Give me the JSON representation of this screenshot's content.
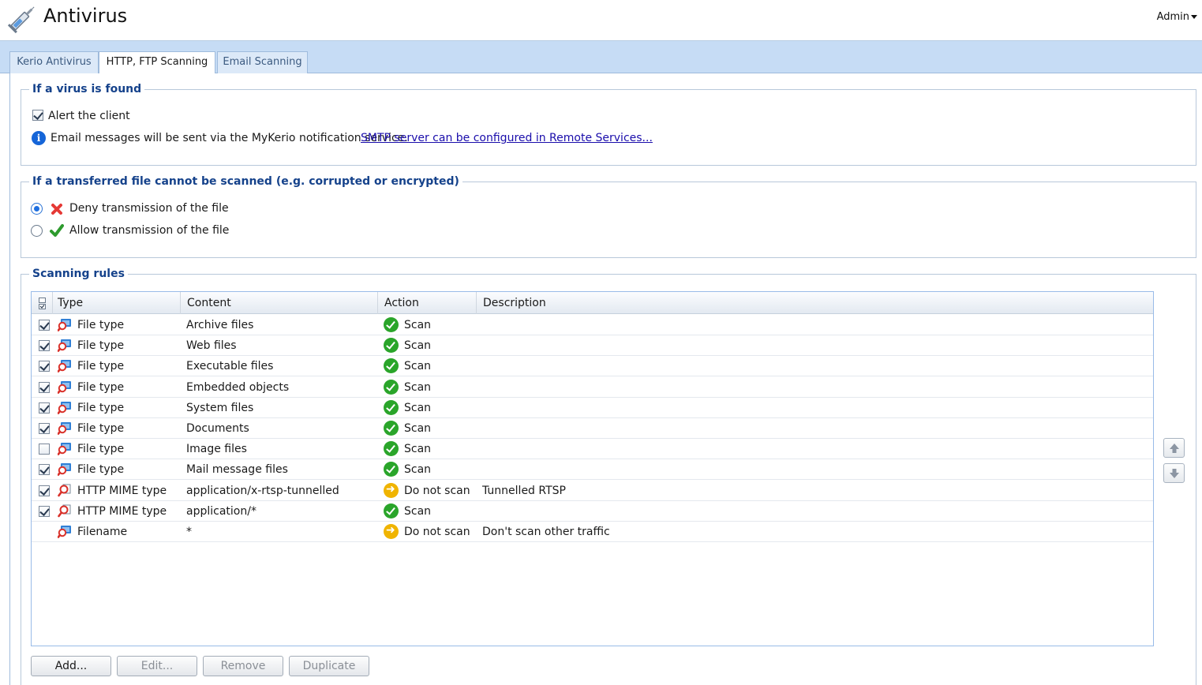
{
  "app": {
    "title": "Antivirus",
    "user_menu": "Admin",
    "icon": "syringe-icon"
  },
  "tabs": [
    {
      "label": "Kerio Antivirus",
      "active": false
    },
    {
      "label": "HTTP, FTP Scanning",
      "active": true
    },
    {
      "label": "Email Scanning",
      "active": false
    }
  ],
  "virus_found": {
    "legend": "If a virus is found",
    "alert_client_label": "Alert the client",
    "alert_client_checked": true,
    "info_text": "Email messages will be sent via the MyKerio notification service.",
    "info_link": "SMTP server can be configured in Remote Services..."
  },
  "cannot_scan": {
    "legend": "If a transferred file cannot be scanned (e.g. corrupted or encrypted)",
    "deny_label": "Deny transmission of the file",
    "allow_label": "Allow transmission of the file",
    "selected": "deny"
  },
  "scanning_rules": {
    "legend": "Scanning rules",
    "columns": {
      "type": "Type",
      "content": "Content",
      "action": "Action",
      "description": "Description"
    },
    "rows": [
      {
        "checked": true,
        "type": "File type",
        "type_icon": "file-type-icon",
        "content": "Archive files",
        "action": "Scan",
        "action_icon": "scan-icon",
        "description": ""
      },
      {
        "checked": true,
        "type": "File type",
        "type_icon": "file-type-icon",
        "content": "Web files",
        "action": "Scan",
        "action_icon": "scan-icon",
        "description": ""
      },
      {
        "checked": true,
        "type": "File type",
        "type_icon": "file-type-icon",
        "content": "Executable files",
        "action": "Scan",
        "action_icon": "scan-icon",
        "description": ""
      },
      {
        "checked": true,
        "type": "File type",
        "type_icon": "file-type-icon",
        "content": "Embedded objects",
        "action": "Scan",
        "action_icon": "scan-icon",
        "description": ""
      },
      {
        "checked": true,
        "type": "File type",
        "type_icon": "file-type-icon",
        "content": "System files",
        "action": "Scan",
        "action_icon": "scan-icon",
        "description": ""
      },
      {
        "checked": true,
        "type": "File type",
        "type_icon": "file-type-icon",
        "content": "Documents",
        "action": "Scan",
        "action_icon": "scan-icon",
        "description": ""
      },
      {
        "checked": false,
        "type": "File type",
        "type_icon": "file-type-icon",
        "content": "Image files",
        "action": "Scan",
        "action_icon": "scan-icon",
        "description": ""
      },
      {
        "checked": true,
        "type": "File type",
        "type_icon": "file-type-icon",
        "content": "Mail message files",
        "action": "Scan",
        "action_icon": "scan-icon",
        "description": ""
      },
      {
        "checked": true,
        "type": "HTTP MIME type",
        "type_icon": "mime-type-icon",
        "content": "application/x-rtsp-tunnelled",
        "action": "Do not scan",
        "action_icon": "no-scan-icon",
        "description": "Tunnelled RTSP"
      },
      {
        "checked": true,
        "type": "HTTP MIME type",
        "type_icon": "mime-type-icon",
        "content": "application/*",
        "action": "Scan",
        "action_icon": "scan-icon",
        "description": ""
      },
      {
        "checked": null,
        "type": "Filename",
        "type_icon": "file-type-icon",
        "content": "*",
        "action": "Do not scan",
        "action_icon": "no-scan-icon",
        "description": "Don't scan other traffic"
      }
    ]
  },
  "buttons": {
    "add": "Add...",
    "edit": "Edit...",
    "remove": "Remove",
    "duplicate": "Duplicate"
  },
  "colors": {
    "accent": "#15428b",
    "tabbar": "#c6dcf5",
    "scan": "#2aa52a",
    "no_scan": "#f0b400",
    "deny": "#e53935",
    "allow": "#2e9b2e"
  }
}
